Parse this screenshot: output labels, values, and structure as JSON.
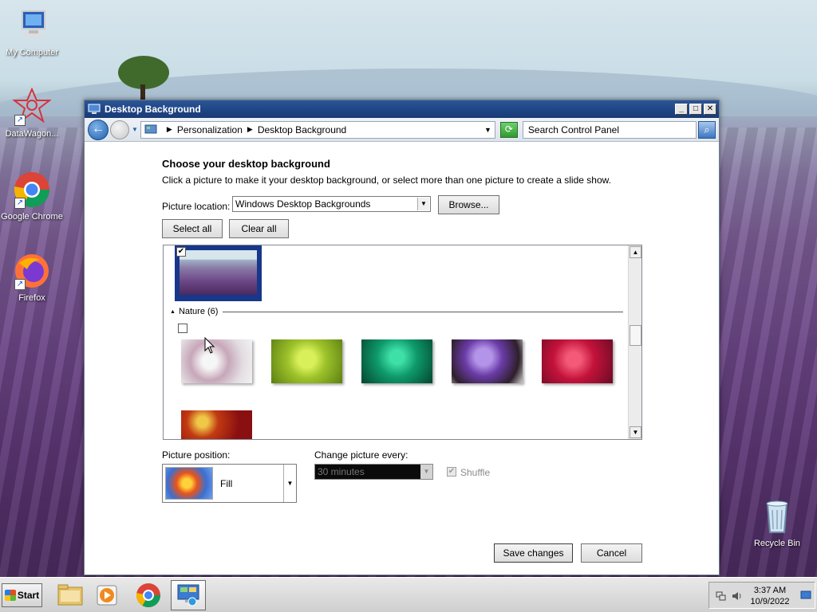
{
  "desktop": {
    "icons": [
      {
        "label": "My Computer"
      },
      {
        "label": "DataWagon..."
      },
      {
        "label": "Google Chrome"
      },
      {
        "label": "Firefox"
      },
      {
        "label": "Recycle Bin"
      }
    ]
  },
  "window": {
    "title": "Desktop Background",
    "controls": {
      "minimize": "_",
      "maximize": "□",
      "close": "✕"
    },
    "address": {
      "crumbs": [
        "Personalization",
        "Desktop Background"
      ],
      "search_placeholder": "Search Control Panel"
    },
    "heading": "Choose your desktop background",
    "description": "Click a picture to make it your desktop background, or select more than one picture to create a slide show.",
    "picture_location": {
      "label": "Picture location:",
      "value": "Windows Desktop Backgrounds"
    },
    "buttons": {
      "browse": "Browse...",
      "select_all": "Select all",
      "clear_all": "Clear all",
      "save": "Save changes",
      "cancel": "Cancel"
    },
    "gallery": {
      "group": {
        "name": "Nature (6)"
      },
      "selected_check": "✔"
    },
    "picture_position": {
      "label": "Picture position:",
      "value": "Fill"
    },
    "change_every": {
      "label": "Change picture every:",
      "value": "30 minutes"
    },
    "shuffle": {
      "label": "Shuffle",
      "check": "✔"
    }
  },
  "taskbar": {
    "start_label": "Start",
    "clock": {
      "time": "3:37 AM",
      "date": "10/9/2022"
    }
  },
  "colors": {
    "titlebar": "#1f4585",
    "selection": "#17378a"
  }
}
